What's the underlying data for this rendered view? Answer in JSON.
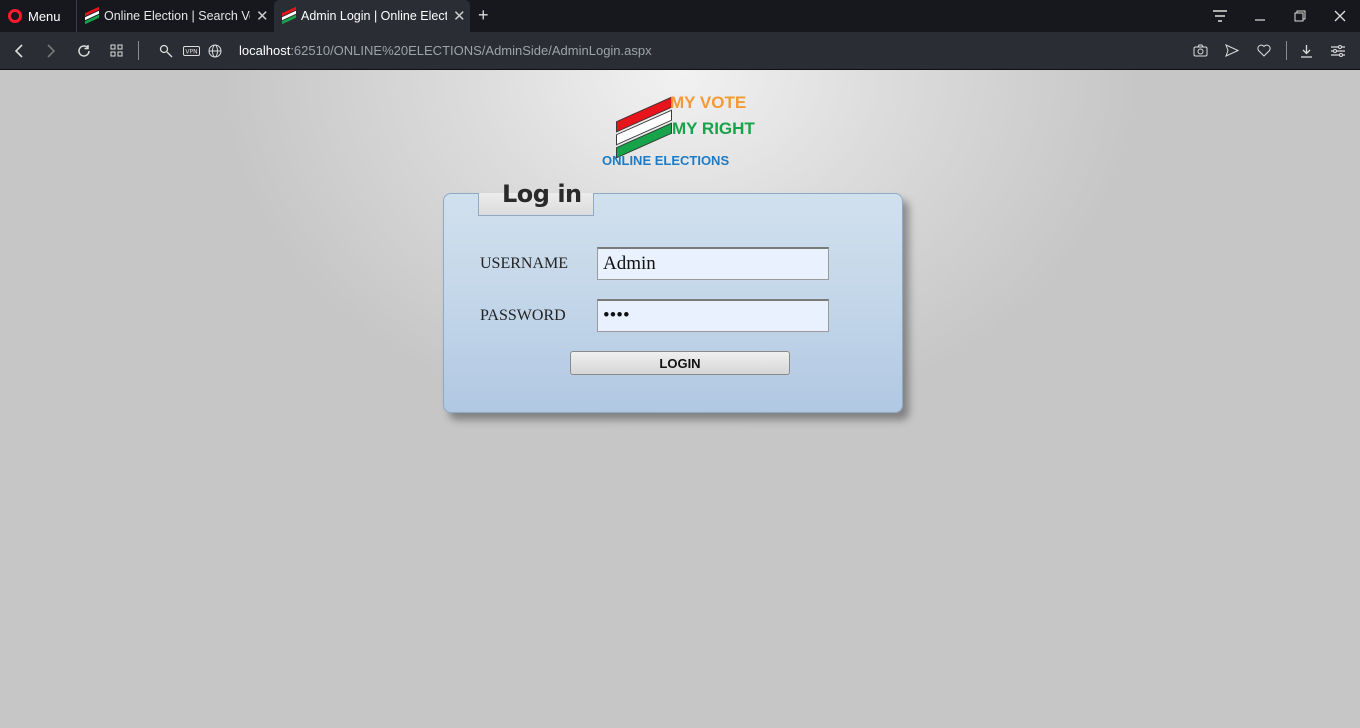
{
  "browser": {
    "menu_label": "Menu",
    "tabs": [
      {
        "title": "Online Election | Search Vot",
        "active": false
      },
      {
        "title": "Admin Login | Online Electi",
        "active": true
      }
    ],
    "new_tab_symbol": "+",
    "url_host": "localhost",
    "url_rest": ":62510/ONLINE%20ELECTIONS/AdminSide/AdminLogin.aspx"
  },
  "logo": {
    "line1": "MY VOTE",
    "line2": "MY RIGHT",
    "line3": "ONLINE ELECTIONS",
    "colors": {
      "red": "#e8131b",
      "white": "#ffffff",
      "green": "#16a34a",
      "orange": "#f39a36",
      "blue": "#1e7cc7"
    }
  },
  "login": {
    "title": "Log in",
    "username_label": "USERNAME",
    "username_value": "Admin",
    "password_label": "PASSWORD",
    "password_value": "••••",
    "button_label": "LOGIN"
  }
}
